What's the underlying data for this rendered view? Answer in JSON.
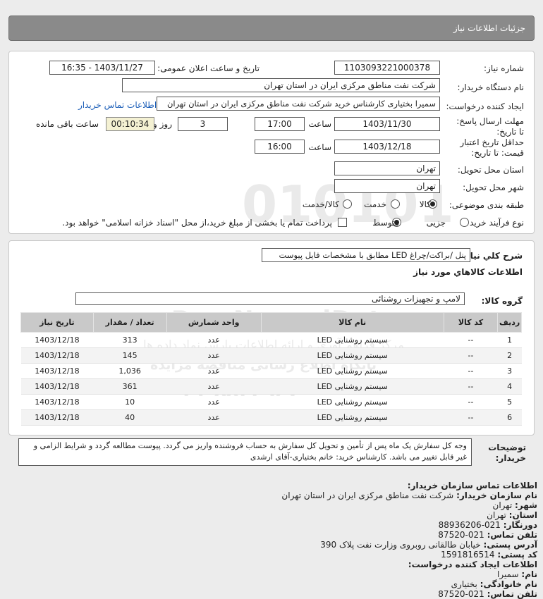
{
  "header": {
    "title": "جزئیات اطلاعات نیاز"
  },
  "need": {
    "number_label": "شماره نیاز:",
    "number": "1103093221000378",
    "announce_label": "تاریخ و ساعت اعلان عمومی:",
    "announce": "1403/11/27 - 16:35",
    "buyer_label": "نام دستگاه خریدار:",
    "buyer": "شرکت نفت مناطق مرکزی ایران در استان تهران",
    "creator_label": "ایجاد کننده درخواست:",
    "creator": "سمیرا بختیاری کارشناس خرید شرکت نفت مناطق مرکزی ایران در استان تهران",
    "contact_link": "اطلاعات تماس خریدار",
    "deadline_label": "مهلت ارسال پاسخ: تا تاریخ:",
    "deadline_date": "1403/11/30",
    "time_word": "ساعت",
    "deadline_time": "17:00",
    "days": "3",
    "days_word": "روز و",
    "remaining": "00:10:34",
    "remaining_word": "ساعت باقی مانده",
    "validity_label": "حداقل تاریخ اعتبار قیمت: تا تاریخ:",
    "validity_date": "1403/12/18",
    "validity_time": "16:00",
    "province_label": "استان محل تحویل:",
    "province": "تهران",
    "city_label": "شهر محل تحویل:",
    "city": "تهران",
    "category_label": "طبقه بندی موضوعی:",
    "category_options": [
      "کالا",
      "خدمت",
      "کالا/خدمت"
    ],
    "process_label": "نوع فرآیند خرید :",
    "process_options": [
      "جزیی",
      "متوسط"
    ],
    "payment_note": "پرداخت تمام یا بخشی از مبلغ خرید،از محل \"اسناد خزانه اسلامی\" خواهد بود."
  },
  "summary": {
    "label": "شرح کلي نياز:",
    "value": "پنل /براکت/چراغ LED مطابق با مشخصات فایل پیوست"
  },
  "goods": {
    "section_title": "اطلاعات کالاهاي مورد نياز",
    "group_label": "گروه کالا:",
    "group_value": "لامپ و تجهیزات روشنائی",
    "columns": [
      "ردیف",
      "کد کالا",
      "نام کالا",
      "واحد شمارش",
      "تعداد / مقدار",
      "تاریخ نیاز"
    ],
    "rows": [
      [
        "1",
        "--",
        "سیستم روشنایی LED",
        "عدد",
        "313",
        "1403/12/18"
      ],
      [
        "2",
        "--",
        "سیستم روشنایی LED",
        "عدد",
        "145",
        "1403/12/18"
      ],
      [
        "3",
        "--",
        "سیستم روشنایی LED",
        "عدد",
        "1,036",
        "1403/12/18"
      ],
      [
        "4",
        "--",
        "سیستم روشنایی LED",
        "عدد",
        "361",
        "1403/12/18"
      ],
      [
        "5",
        "--",
        "سیستم روشنایی LED",
        "عدد",
        "10",
        "1403/12/18"
      ],
      [
        "6",
        "--",
        "سیستم روشنایی LED",
        "عدد",
        "40",
        "1403/12/18"
      ]
    ]
  },
  "notes": {
    "label": "توضیحات خریدار:",
    "text": "وجه کل سفارش یک ماه پس از تأمین و تحویل کل سفارش به حساب فروشنده واریز می گردد. پیوست مطالعه گردد و شرایط الزامی و غیر قابل تغییر می باشد. کارشناس خرید: خانم بختیاری-آقای ارشدی"
  },
  "contact": {
    "title": "اطلاعات تماس سازمان خریدار:",
    "org_label": "نام سازمان خریدار:",
    "org": "شرکت نفت مناطق مرکزی ایران در استان تهران",
    "city_label": "شهر:",
    "city": "تهران",
    "province_label": "استان:",
    "province": "تهران",
    "fax_label": "دورنگار:",
    "fax": "021-88936206",
    "phone_label": "تلفن تماس:",
    "phone": "021-87520",
    "address_label": "آدرس پستی:",
    "address": "خیابان طالقانی روبروی وزارت نفت پلاک 390",
    "postal_label": "کد پستی:",
    "postal": "1591816514",
    "creator_title": "اطلاعات ایجاد کننده درخواست:",
    "name_label": "نام:",
    "name": "سمیرا",
    "family_label": "نام خانوادگی:",
    "family": "بختیاری",
    "creator_phone_label": "تلفن تماس:",
    "creator_phone": "021-87520"
  },
  "watermark": {
    "brand": "ParsNamadData",
    "line1": "مرکز فراهم آوری و ارائه اطلاعات پارس نماد داده ها",
    "line2": "پایگاه اطلاع رسانی مناقصه مزایده",
    "phone": "۰۲۱-۸۸۳۴۹۶۷۰"
  }
}
